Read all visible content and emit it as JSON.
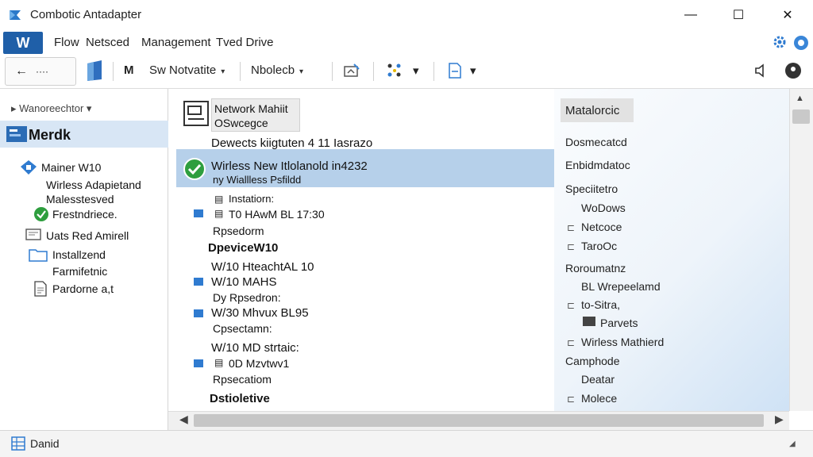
{
  "window": {
    "title": "Combotic Antadapter",
    "min_symbol": "—",
    "max_symbol": "☐",
    "close_symbol": "✕"
  },
  "menu": {
    "badge": "W",
    "items": [
      "Flow",
      "Netsced",
      "Management",
      "Tved Drive"
    ]
  },
  "toolbar": {
    "back_symbol": "←",
    "more_symbol": "····",
    "item1": "M",
    "item2": "Sw Notvatite",
    "item3": "Nbolecb",
    "caret": "▾"
  },
  "sidebar": {
    "header": "Wanoreechtor",
    "selected": "Merdk",
    "items": [
      {
        "label": "Mainer W10"
      },
      {
        "label": "Wirless Adapietand"
      },
      {
        "label": "Malesstesved"
      },
      {
        "label": "Frestndriece."
      },
      {
        "label": "Uats Red Amirell"
      },
      {
        "label": "Installzend"
      },
      {
        "label": "Farmifetnic"
      },
      {
        "label": "Pardorne a,t"
      }
    ]
  },
  "main": {
    "network_title_1": "Network Mahiit",
    "network_title_2": "OSwcegce",
    "rows": [
      "Dewects kiigtuten 4  11 Iasrazo",
      "Wirless New Itlolanold in4232",
      "ny Wiallless Psfildd",
      "Instatiorn:",
      "T0 HAwM BL 17:30",
      "Rpsedorm",
      "W/10 HteachtAL 10",
      "W/10 MAHS",
      "Dy Rpsedron:",
      "W/30 Mhvux BL95",
      "Cpsectamn:",
      "W/10 MD strtaic:",
      "0D Mzvtwv1",
      "Rpsecatiom"
    ],
    "heading_device": "DpeviceW10",
    "heading_last": "Dstioletive"
  },
  "right_panel": {
    "tab": "Matalorcic",
    "items": [
      "Dosmecatcd",
      "Enbidmdatoc",
      "Speciitetro",
      "WoDows",
      "Netcoce",
      "TaroOc",
      "Roroumatnz",
      "BL Wrepeelamd",
      "to-Sitra,",
      "Parvets",
      "Wirless Mathierd",
      "Camphode",
      "Deatar",
      "Molece"
    ]
  },
  "statusbar": {
    "text": "Danid"
  },
  "colors": {
    "accent": "#1f5fa8",
    "selection": "#b6d0ea",
    "sidebar_selected": "#d8e6f5",
    "check_green": "#2e9e3e"
  },
  "icons": {
    "app": "network-app-icon",
    "check": "check-circle-icon",
    "gear": "gear-icon",
    "monitor": "monitor-icon",
    "folder": "folder-icon"
  }
}
